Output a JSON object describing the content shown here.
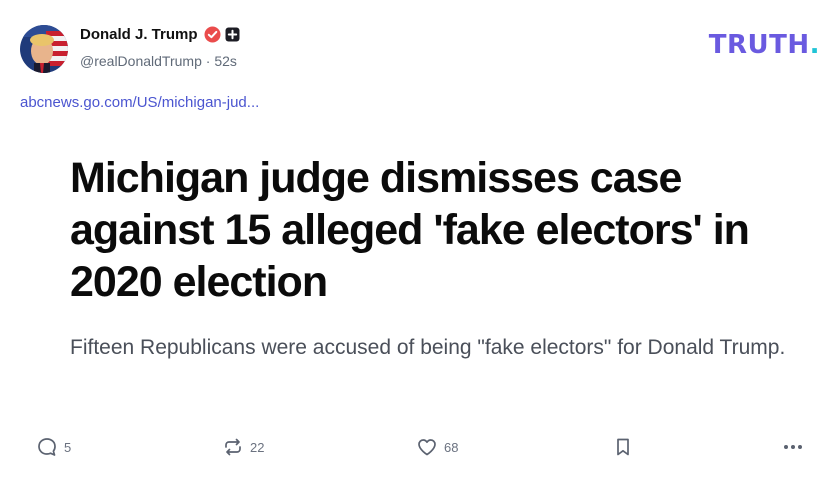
{
  "author": {
    "name": "Donald J. Trump",
    "handle": "@realDonaldTrump",
    "separator": "·",
    "time": "52s"
  },
  "brand": {
    "logo_text": "TRUTH",
    "logo_dot": ".",
    "color_primary": "#6a5ae0",
    "color_dot": "#20c4d6"
  },
  "link": {
    "url_text": "abcnews.go.com/US/michigan-jud..."
  },
  "card": {
    "headline": "Michigan judge dismisses case against 15 alleged 'fake electors' in 2020 election",
    "summary": "Fifteen Republicans were accused of being \"fake electors\" for Donald Trump."
  },
  "actions": {
    "replies": "5",
    "retruths": "22",
    "likes": "68"
  },
  "icons": {
    "verified": "verified-badge-icon",
    "plus": "plus-badge-icon",
    "reply": "reply-icon",
    "retruth": "retruth-icon",
    "like": "heart-icon",
    "bookmark": "bookmark-icon",
    "more": "more-icon"
  }
}
